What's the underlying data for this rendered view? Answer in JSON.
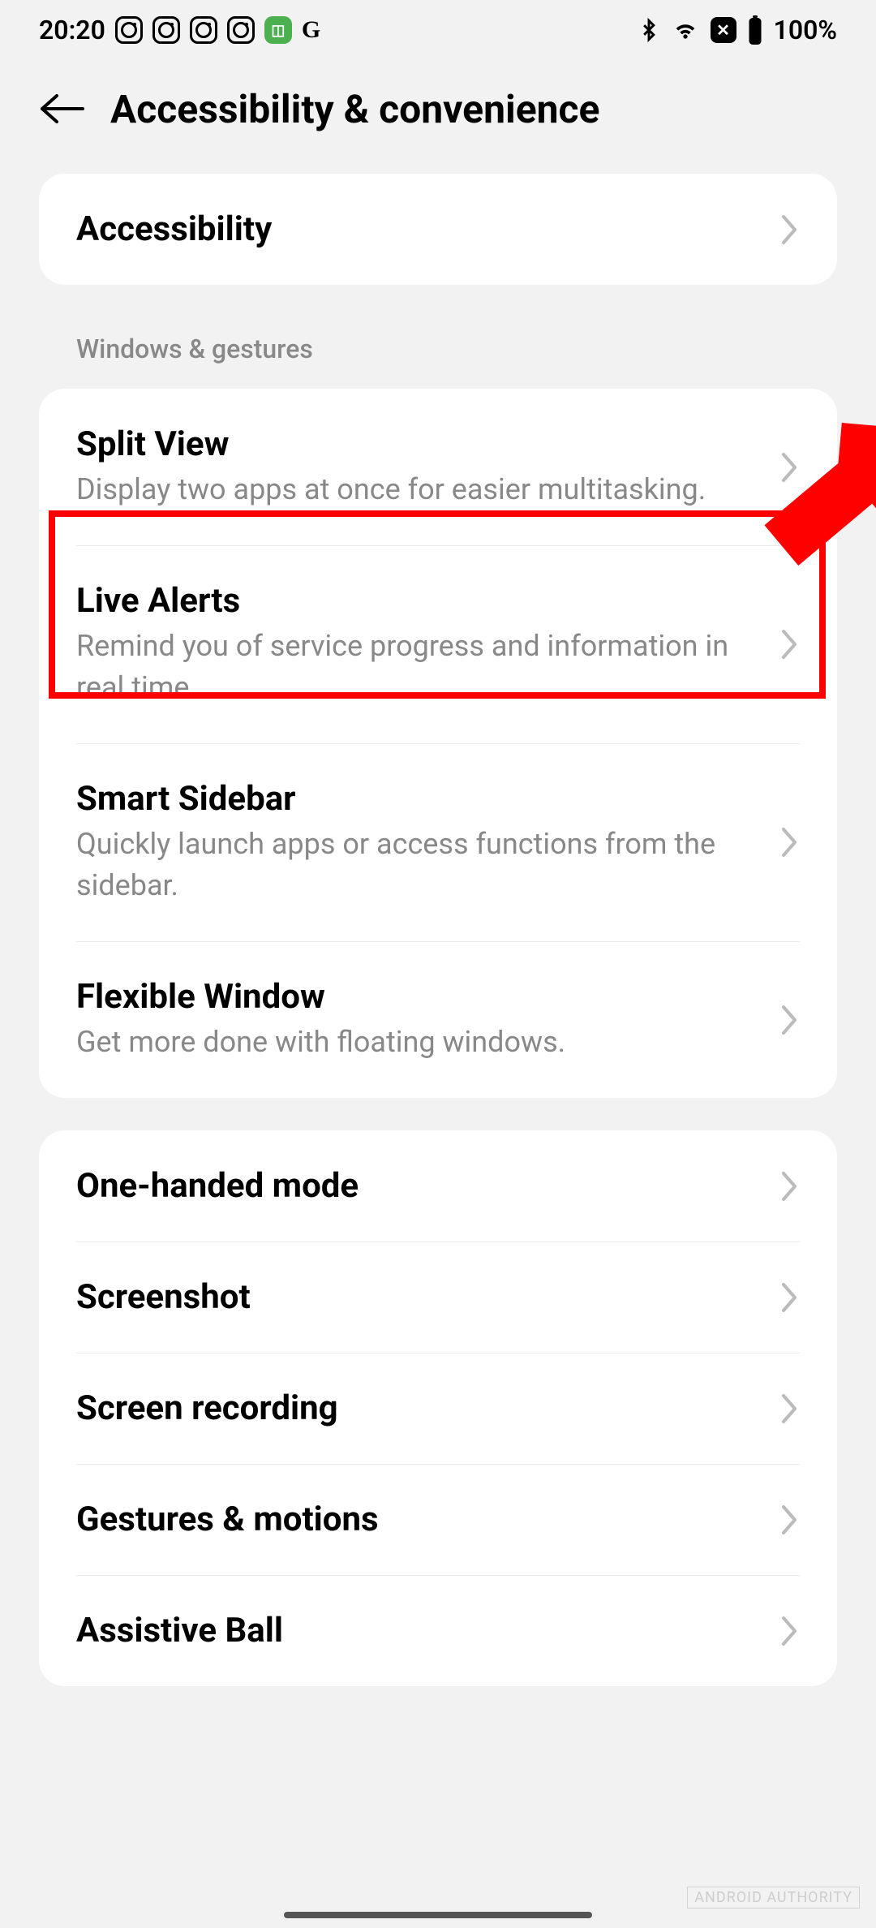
{
  "status": {
    "time": "20:20",
    "battery": "100%"
  },
  "header": {
    "title": "Accessibility & convenience"
  },
  "card1": {
    "accessibility": "Accessibility"
  },
  "section1_label": "Windows & gestures",
  "card2": {
    "splitview": {
      "title": "Split View",
      "sub": "Display two apps at once for easier multitasking."
    },
    "livealerts": {
      "title": "Live Alerts",
      "sub": "Remind you of service progress and information in real time."
    },
    "smartsidebar": {
      "title": "Smart Sidebar",
      "sub": "Quickly launch apps or access functions from the sidebar."
    },
    "flexible": {
      "title": "Flexible Window",
      "sub": "Get more done with floating windows."
    }
  },
  "card3": {
    "onehand": "One-handed mode",
    "screenshot": "Screenshot",
    "recording": "Screen recording",
    "gestures": "Gestures & motions",
    "assistive": "Assistive Ball"
  },
  "watermark": "ANDROID AUTHORITY"
}
